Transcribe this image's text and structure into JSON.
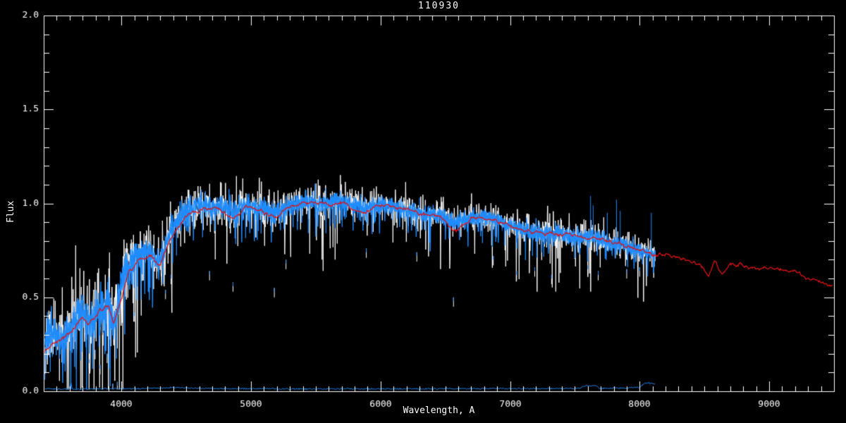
{
  "chart_data": {
    "type": "line",
    "title": "110930",
    "xlabel": "Wavelength, A",
    "ylabel": "Flux",
    "xlim": [
      3400,
      9500
    ],
    "ylim": [
      0.0,
      2.0
    ],
    "x_major_ticks": [
      4000,
      5000,
      6000,
      7000,
      8000,
      9000
    ],
    "x_tick_labels": [
      "4000",
      "5000",
      "6000",
      "7000",
      "8000",
      "9000"
    ],
    "x_minor_step": 100,
    "y_major_ticks": [
      0.0,
      0.5,
      1.0,
      1.5,
      2.0
    ],
    "y_tick_labels": [
      "0.0",
      "0.5",
      "1.0",
      "1.5",
      "2.0"
    ],
    "y_minor_step": 0.1,
    "grid": false,
    "background_color": "#000000",
    "axis_color": "#FFFFFF",
    "series": [
      {
        "name": "observed-spectrum-raw",
        "color": "#FFFFFF",
        "style": "noisy",
        "wavelength_range": [
          3410,
          8120
        ],
        "noise_scale": 1.9
      },
      {
        "name": "observed-spectrum",
        "color": "#1E8CFF",
        "style": "noisy",
        "wavelength_range": [
          3410,
          8120
        ],
        "noise_scale": 1.0
      },
      {
        "name": "model-template",
        "color": "#DC1414",
        "style": "smooth",
        "wavelength_range": [
          3400,
          9492
        ]
      },
      {
        "name": "sky-error-spectrum",
        "color": "#1E8CFF",
        "style": "flat-near-zero",
        "wavelength_range": [
          3410,
          8120
        ]
      }
    ],
    "continuum_points": [
      [
        3410,
        0.27
      ],
      [
        3450,
        0.33
      ],
      [
        3500,
        0.3
      ],
      [
        3550,
        0.27
      ],
      [
        3600,
        0.36
      ],
      [
        3650,
        0.4
      ],
      [
        3700,
        0.45
      ],
      [
        3730,
        0.36
      ],
      [
        3780,
        0.38
      ],
      [
        3820,
        0.45
      ],
      [
        3870,
        0.42
      ],
      [
        3910,
        0.48
      ],
      [
        3940,
        0.35
      ],
      [
        3980,
        0.5
      ],
      [
        4020,
        0.62
      ],
      [
        4080,
        0.7
      ],
      [
        4150,
        0.72
      ],
      [
        4220,
        0.74
      ],
      [
        4280,
        0.68
      ],
      [
        4320,
        0.72
      ],
      [
        4380,
        0.86
      ],
      [
        4450,
        0.92
      ],
      [
        4520,
        0.97
      ],
      [
        4600,
        1.0
      ],
      [
        4680,
        0.97
      ],
      [
        4760,
        0.99
      ],
      [
        4861,
        0.95
      ],
      [
        4940,
        0.99
      ],
      [
        5020,
        0.97
      ],
      [
        5100,
        0.98
      ],
      [
        5180,
        0.94
      ],
      [
        5260,
        0.98
      ],
      [
        5350,
        1.0
      ],
      [
        5450,
        1.01
      ],
      [
        5560,
        1.0
      ],
      [
        5680,
        1.01
      ],
      [
        5780,
        1.0
      ],
      [
        5890,
        0.97
      ],
      [
        6000,
        1.0
      ],
      [
        6100,
        0.98
      ],
      [
        6200,
        0.96
      ],
      [
        6300,
        0.95
      ],
      [
        6400,
        0.94
      ],
      [
        6500,
        0.93
      ],
      [
        6563,
        0.9
      ],
      [
        6650,
        0.92
      ],
      [
        6750,
        0.92
      ],
      [
        6870,
        0.93
      ],
      [
        6960,
        0.89
      ],
      [
        7060,
        0.87
      ],
      [
        7160,
        0.85
      ],
      [
        7270,
        0.84
      ],
      [
        7380,
        0.84
      ],
      [
        7500,
        0.82
      ],
      [
        7620,
        0.83
      ],
      [
        7700,
        0.81
      ],
      [
        7780,
        0.79
      ],
      [
        7860,
        0.78
      ],
      [
        7950,
        0.76
      ],
      [
        8030,
        0.74
      ],
      [
        8120,
        0.73
      ]
    ],
    "model_points": [
      [
        3400,
        0.21
      ],
      [
        3500,
        0.27
      ],
      [
        3600,
        0.31
      ],
      [
        3700,
        0.4
      ],
      [
        3750,
        0.36
      ],
      [
        3820,
        0.42
      ],
      [
        3900,
        0.47
      ],
      [
        3940,
        0.36
      ],
      [
        3990,
        0.47
      ],
      [
        4060,
        0.64
      ],
      [
        4150,
        0.7
      ],
      [
        4230,
        0.72
      ],
      [
        4300,
        0.66
      ],
      [
        4360,
        0.78
      ],
      [
        4450,
        0.89
      ],
      [
        4550,
        0.95
      ],
      [
        4650,
        0.98
      ],
      [
        4750,
        0.96
      ],
      [
        4861,
        0.91
      ],
      [
        4950,
        0.98
      ],
      [
        5050,
        0.97
      ],
      [
        5175,
        0.92
      ],
      [
        5280,
        0.98
      ],
      [
        5400,
        1.0
      ],
      [
        5550,
        1.0
      ],
      [
        5700,
        1.0
      ],
      [
        5890,
        0.95
      ],
      [
        6000,
        0.99
      ],
      [
        6150,
        0.97
      ],
      [
        6300,
        0.95
      ],
      [
        6450,
        0.93
      ],
      [
        6563,
        0.86
      ],
      [
        6700,
        0.92
      ],
      [
        6850,
        0.92
      ],
      [
        7000,
        0.88
      ],
      [
        7150,
        0.85
      ],
      [
        7300,
        0.84
      ],
      [
        7450,
        0.83
      ],
      [
        7600,
        0.82
      ],
      [
        7750,
        0.8
      ],
      [
        7900,
        0.77
      ],
      [
        8050,
        0.74
      ],
      [
        8120,
        0.73
      ],
      [
        8250,
        0.72
      ],
      [
        8400,
        0.7
      ],
      [
        8480,
        0.67
      ],
      [
        8530,
        0.62
      ],
      [
        8580,
        0.69
      ],
      [
        8640,
        0.63
      ],
      [
        8700,
        0.68
      ],
      [
        8800,
        0.67
      ],
      [
        8900,
        0.66
      ],
      [
        9000,
        0.65
      ],
      [
        9100,
        0.64
      ],
      [
        9200,
        0.63
      ],
      [
        9300,
        0.61
      ],
      [
        9400,
        0.58
      ],
      [
        9492,
        0.56
      ]
    ],
    "noise_sigma_points": [
      [
        3400,
        0.085
      ],
      [
        3700,
        0.095
      ],
      [
        3950,
        0.1
      ],
      [
        4100,
        0.065
      ],
      [
        4500,
        0.055
      ],
      [
        5000,
        0.048
      ],
      [
        5500,
        0.042
      ],
      [
        6000,
        0.038
      ],
      [
        6500,
        0.036
      ],
      [
        7000,
        0.036
      ],
      [
        7400,
        0.042
      ],
      [
        7700,
        0.038
      ],
      [
        8120,
        0.032
      ]
    ],
    "absorption_spikes": [
      [
        3750,
        0.15
      ],
      [
        3797,
        0.2
      ],
      [
        3835,
        0.12
      ],
      [
        3889,
        0.18
      ],
      [
        3933,
        0.02
      ],
      [
        3968,
        0.03
      ],
      [
        4101,
        0.4
      ],
      [
        4340,
        0.52
      ],
      [
        4383,
        0.6
      ],
      [
        4680,
        0.62
      ],
      [
        4861,
        0.56
      ],
      [
        5180,
        0.53
      ],
      [
        5270,
        0.68
      ],
      [
        5890,
        0.74
      ],
      [
        6280,
        0.72
      ],
      [
        6563,
        0.48
      ],
      [
        6870,
        0.7
      ],
      [
        7050,
        0.62
      ],
      [
        7190,
        0.64
      ],
      [
        7320,
        0.6
      ],
      [
        7600,
        0.65
      ],
      [
        7680,
        0.62
      ],
      [
        7900,
        0.63
      ],
      [
        8000,
        0.64
      ]
    ],
    "emission_spikes": [
      [
        5577,
        1.08
      ],
      [
        6300,
        1.03
      ],
      [
        7621,
        1.04
      ],
      [
        7641,
        0.99
      ],
      [
        7750,
        0.95
      ],
      [
        7821,
        1.02
      ],
      [
        7850,
        0.96
      ],
      [
        8090,
        0.95
      ]
    ],
    "zero_line_points": [
      [
        3410,
        0.012
      ],
      [
        3600,
        0.012
      ],
      [
        3610,
        0.05
      ],
      [
        3620,
        0.012
      ],
      [
        4200,
        0.015
      ],
      [
        4400,
        0.02
      ],
      [
        4600,
        0.015
      ],
      [
        5500,
        0.012
      ],
      [
        7540,
        0.015
      ],
      [
        7580,
        0.03
      ],
      [
        7650,
        0.03
      ],
      [
        7700,
        0.015
      ],
      [
        8000,
        0.02
      ],
      [
        8040,
        0.045
      ],
      [
        8120,
        0.04
      ]
    ]
  }
}
